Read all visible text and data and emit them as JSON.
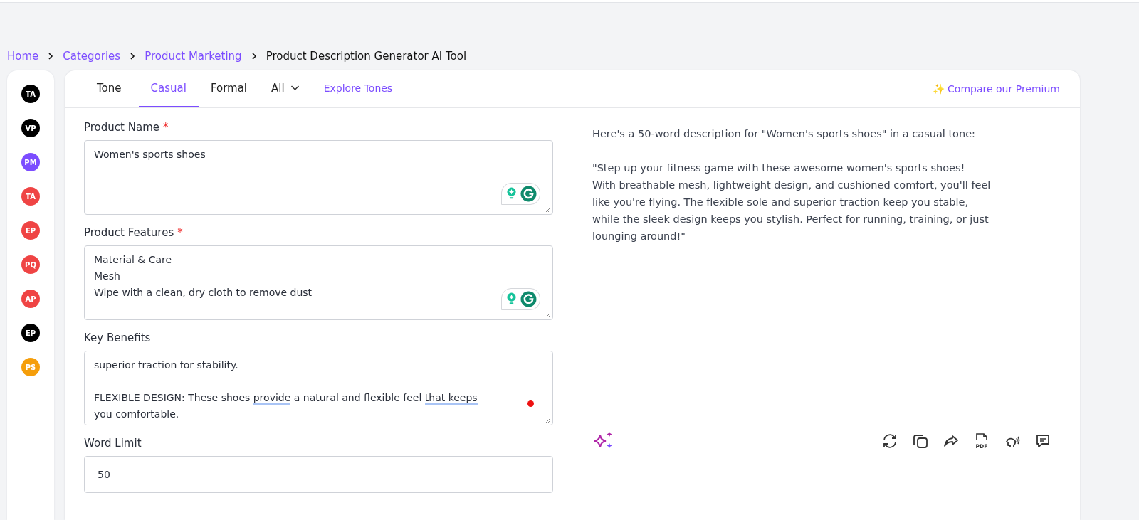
{
  "breadcrumb": {
    "links": [
      "Home",
      "Categories",
      "Product Marketing"
    ],
    "current": "Product Description Generator AI Tool"
  },
  "sidebar": {
    "avatars": [
      {
        "initials": "TA",
        "color": "#000000"
      },
      {
        "initials": "VP",
        "color": "#000000"
      },
      {
        "initials": "PM",
        "color": "#7c4dff"
      },
      {
        "initials": "TA",
        "color": "#ef4444"
      },
      {
        "initials": "EP",
        "color": "#ef4444"
      },
      {
        "initials": "PQ",
        "color": "#ef4444"
      },
      {
        "initials": "AP",
        "color": "#ef4444"
      },
      {
        "initials": "EP",
        "color": "#000000"
      },
      {
        "initials": "PS",
        "color": "#f59e0b"
      }
    ]
  },
  "tone_label": "Tone",
  "tabs": [
    {
      "label": "Casual",
      "kind": "tab",
      "selected": true
    },
    {
      "label": "Formal",
      "kind": "tab",
      "selected": false
    },
    {
      "label": "All",
      "kind": "dropdown",
      "selected": false
    }
  ],
  "explore_link": "Explore Tones",
  "premium_link": {
    "icon": "✨",
    "label": "Compare our Premium"
  },
  "form": [
    {
      "label": "Product Name",
      "required_marker": "*",
      "kind": "textarea",
      "value": "Women's sports shoes",
      "grammar_widget": true,
      "error_dot": false
    },
    {
      "label": "Product Features",
      "required_marker": "*",
      "kind": "textarea",
      "value": "Material & Care\nMesh\nWipe with a clean, dry cloth to remove dust",
      "grammar_widget": true,
      "error_dot": false
    },
    {
      "label": "Key Benefits",
      "kind": "textarea",
      "value": "superior traction for stability.\n\nFLEXIBLE DESIGN: These shoes **provide** a natural and flexible feel **that keeps** you comfortable.",
      "grammar_widget": false,
      "error_dot": true
    },
    {
      "label": "Word Limit",
      "kind": "input",
      "value": "50"
    }
  ],
  "output": {
    "paragraphs": [
      "Here's a 50-word description for \"Women's sports shoes\" in a casual tone:",
      "\"Step up your fitness game with these awesome women's sports shoes! With breathable mesh, lightweight design, and cushioned comfort, you'll feel like you're flying. The flexible sole and superior traction keep you stable, while the sleek design keeps you stylish. Perfect for running, training, or just lounging around!\""
    ]
  },
  "actions": [
    {
      "kind": "regenerate"
    },
    {
      "kind": "copy"
    },
    {
      "kind": "share"
    },
    {
      "kind": "pdf",
      "label": "PDF"
    },
    {
      "kind": "speak"
    },
    {
      "kind": "feedback"
    }
  ]
}
